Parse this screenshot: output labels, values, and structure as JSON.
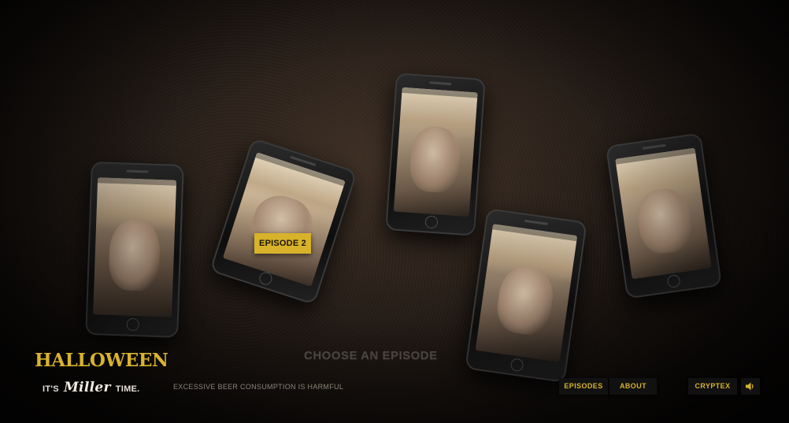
{
  "episode_badge": "EPISODE 2",
  "prompt": "CHOOSE AN EPISODE",
  "logo": {
    "title": "HALLOWEEN",
    "tag_left": "IT'S",
    "tag_brand": "Miller",
    "tag_right": "TIME."
  },
  "disclaimer": "EXCESSIVE BEER CONSUMPTION IS HARMFUL",
  "nav": {
    "episodes": "EPISODES",
    "about": "ABOUT",
    "cryptex": "CRYPTEX"
  },
  "icons": {
    "sound": "speaker-icon"
  },
  "colors": {
    "accent": "#d7b22a",
    "background": "#1a1612"
  }
}
